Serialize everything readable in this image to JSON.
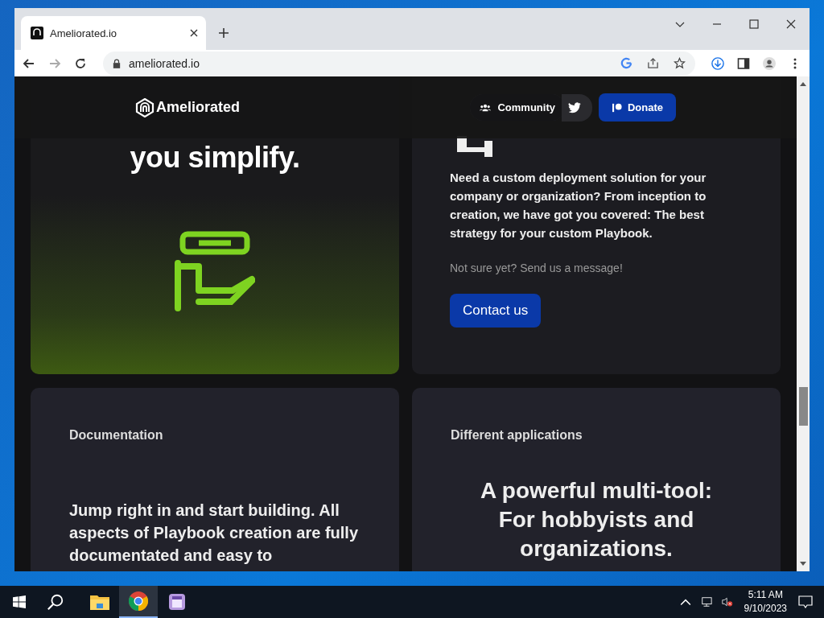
{
  "browser": {
    "tab_title": "Ameliorated.io",
    "url": "ameliorated.io"
  },
  "site_header": {
    "logo": "Ameliorated",
    "nav": [
      {
        "kind": "community",
        "label": "Community"
      },
      {
        "kind": "twitter"
      },
      {
        "kind": "donate",
        "label": "Donate"
      }
    ]
  },
  "cards": [
    {
      "kind": "hero",
      "heading": "you simplify."
    },
    {
      "kind": "service",
      "body": "Need a custom deployment solution for your company or organization? From inception to creation, we have got you covered: The best strategy for your custom Playbook.",
      "note": "Not sure yet? Send us a message!",
      "button": "Contact us"
    },
    {
      "kind": "docs",
      "label": "Documentation",
      "body": "Jump right in and start building. All aspects of Playbook creation are fully documentated and easy to"
    },
    {
      "kind": "apps",
      "label": "Different applications",
      "body": "A powerful multi-tool: For hobbyists and organizations."
    }
  ],
  "taskbar": {
    "apps": [
      {
        "kind": "explorer",
        "selected": false
      },
      {
        "kind": "chrome",
        "selected": true
      },
      {
        "kind": "app",
        "selected": false
      }
    ],
    "time": "5:11 AM",
    "date": "9/10/2023"
  }
}
